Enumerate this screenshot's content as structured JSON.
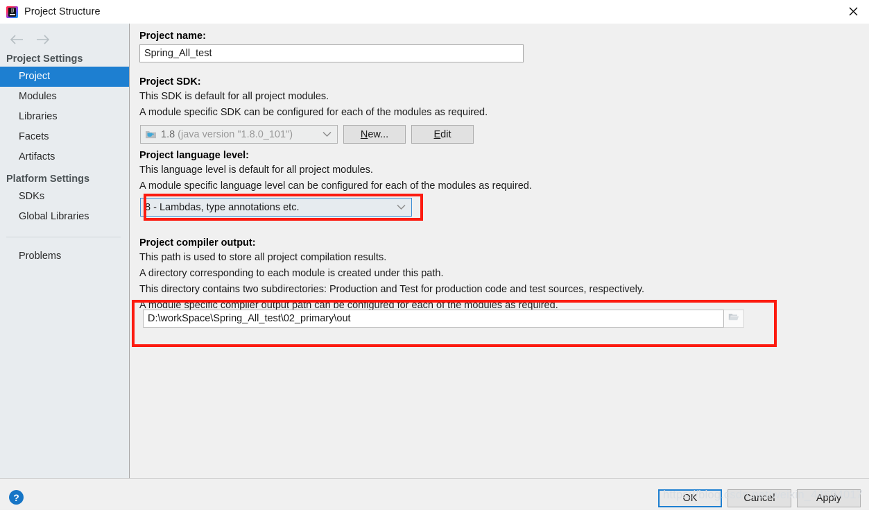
{
  "window": {
    "title": "Project Structure",
    "app_icon": "intellij-idea-logo",
    "close_icon": "close-icon"
  },
  "sidebar": {
    "back_icon": "arrow-left-icon",
    "forward_icon": "arrow-right-icon",
    "groups": [
      {
        "header": "Project Settings",
        "items": [
          {
            "label": "Project",
            "selected": true
          },
          {
            "label": "Modules",
            "selected": false
          },
          {
            "label": "Libraries",
            "selected": false
          },
          {
            "label": "Facets",
            "selected": false
          },
          {
            "label": "Artifacts",
            "selected": false
          }
        ]
      },
      {
        "header": "Platform Settings",
        "items": [
          {
            "label": "SDKs",
            "selected": false
          },
          {
            "label": "Global Libraries",
            "selected": false
          }
        ]
      }
    ],
    "standalone_item": "Problems"
  },
  "main": {
    "project_name": {
      "label": "Project name:",
      "value": "Spring_All_test"
    },
    "project_sdk": {
      "label": "Project SDK:",
      "desc1": "This SDK is default for all project modules.",
      "desc2": "A module specific SDK can be configured for each of the modules as required.",
      "sdk_icon": "java-sdk-folder-icon",
      "value_version": "1.8",
      "value_detail": "(java version \"1.8.0_101\")",
      "dropdown_icon": "chevron-down-icon",
      "new_button": "New...",
      "new_button_mnemonic": "N",
      "new_button_rest": "ew...",
      "edit_button": "Edit",
      "edit_button_mnemonic": "E",
      "edit_button_rest": "dit"
    },
    "language_level": {
      "label": "Project language level:",
      "desc1": "This language level is default for all project modules.",
      "desc2": "A module specific language level can be configured for each of the modules as required.",
      "value": "8 - Lambdas, type annotations etc.",
      "dropdown_icon": "chevron-down-icon"
    },
    "compiler_output": {
      "label": "Project compiler output:",
      "desc1": "This path is used to store all project compilation results.",
      "desc2": "A directory corresponding to each module is created under this path.",
      "desc3": "This directory contains two subdirectories: Production and Test for production code and test sources, respectively.",
      "desc4": "A module specific compiler output path can be configured for each of the modules as required.",
      "path_value": "D:\\workSpace\\Spring_All_test\\02_primary\\out",
      "browse_icon": "folder-open-icon"
    }
  },
  "footer": {
    "help_icon": "help-question-icon",
    "ok_label": "OK",
    "cancel_label": "Cancel",
    "apply_label": "Apply"
  },
  "overlay": {
    "watermark": "https://blog.csdn.net/weixin_44694017",
    "highlight_color": "#fc1b10"
  }
}
